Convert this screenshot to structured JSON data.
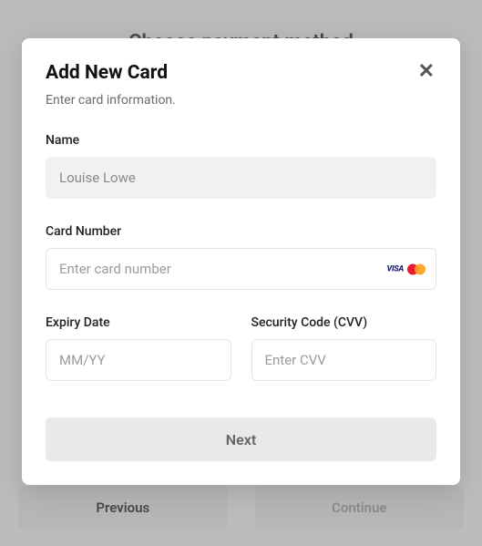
{
  "background": {
    "heading": "Choose payment method",
    "previous_label": "Previous",
    "continue_label": "Continue"
  },
  "modal": {
    "title": "Add New Card",
    "subtitle": "Enter card information.",
    "close_glyph": "✕",
    "name": {
      "label": "Name",
      "value": "Louise Lowe"
    },
    "card_number": {
      "label": "Card Number",
      "placeholder": "Enter card number",
      "visa_text": "VISA"
    },
    "expiry": {
      "label": "Expiry Date",
      "placeholder": "MM/YY"
    },
    "cvv": {
      "label": "Security Code (CVV)",
      "placeholder": "Enter CVV"
    },
    "next_label": "Next"
  }
}
